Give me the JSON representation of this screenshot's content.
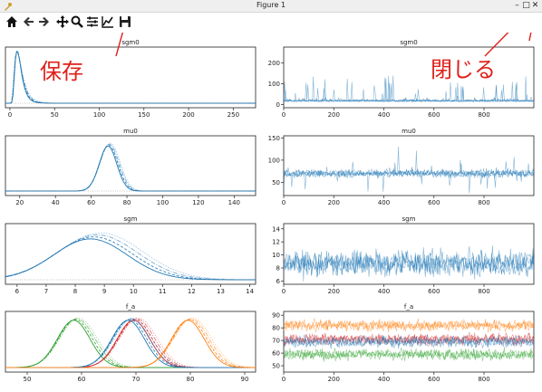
{
  "window": {
    "title": "Figure 1",
    "min_glyph": "–",
    "max_glyph": "□",
    "close_glyph": "✕"
  },
  "toolbar": {
    "buttons": [
      "home-icon",
      "back-icon",
      "forward-icon",
      "pan-icon",
      "zoom-icon",
      "configure-subplots-icon",
      "edit-axes-icon",
      "save-icon"
    ]
  },
  "annotations": {
    "save_label": "保存",
    "close_label": "閉じる",
    "color": "#e0201a"
  },
  "colors": {
    "blue": "#1f77b4",
    "orange": "#ff7f0e",
    "green": "#2ca02c",
    "red": "#d62728"
  },
  "chart_data": [
    {
      "type": "line",
      "title": "sgm0",
      "xticks": [
        0,
        50,
        100,
        150,
        200,
        250
      ],
      "xlim": [
        -5,
        275
      ],
      "peak": 10,
      "shape": "skewed-right"
    },
    {
      "type": "line",
      "title": "sgm0",
      "xticks": [
        0,
        200,
        400,
        600,
        800
      ],
      "yticks": [
        0,
        100,
        200
      ],
      "xlim": [
        0,
        999
      ],
      "ylim": [
        -15,
        275
      ]
    },
    {
      "type": "line",
      "title": "mu0",
      "xticks": [
        20,
        40,
        60,
        80,
        100,
        120,
        140
      ],
      "xlim": [
        12,
        152
      ],
      "peak": 70
    },
    {
      "type": "line",
      "title": "mu0",
      "xticks": [
        0,
        200,
        400,
        600,
        800
      ],
      "yticks": [
        50,
        100,
        150
      ],
      "xlim": [
        0,
        999
      ],
      "ylim": [
        20,
        155
      ]
    },
    {
      "type": "line",
      "title": "sgm",
      "xticks": [
        6,
        7,
        8,
        9,
        10,
        11,
        12,
        13,
        14
      ],
      "xlim": [
        5.6,
        14.2
      ],
      "peak": 8.7
    },
    {
      "type": "line",
      "title": "sgm",
      "xticks": [
        0,
        200,
        400,
        600,
        800
      ],
      "yticks": [
        6,
        8,
        10,
        12,
        14
      ],
      "xlim": [
        0,
        999
      ],
      "ylim": [
        5.5,
        14.8
      ]
    },
    {
      "type": "line",
      "title": "f_a",
      "xticks": [
        50,
        60,
        70,
        80,
        90
      ],
      "xlim": [
        46,
        92
      ],
      "peaks": [
        59,
        70,
        69,
        80
      ]
    },
    {
      "type": "line",
      "title": "f_a",
      "xticks": [
        0,
        200,
        400,
        600,
        800
      ],
      "yticks": [
        50,
        60,
        70,
        80,
        90
      ],
      "xlim": [
        0,
        999
      ],
      "ylim": [
        45,
        93
      ],
      "levels": [
        82,
        71,
        69,
        59
      ]
    }
  ]
}
